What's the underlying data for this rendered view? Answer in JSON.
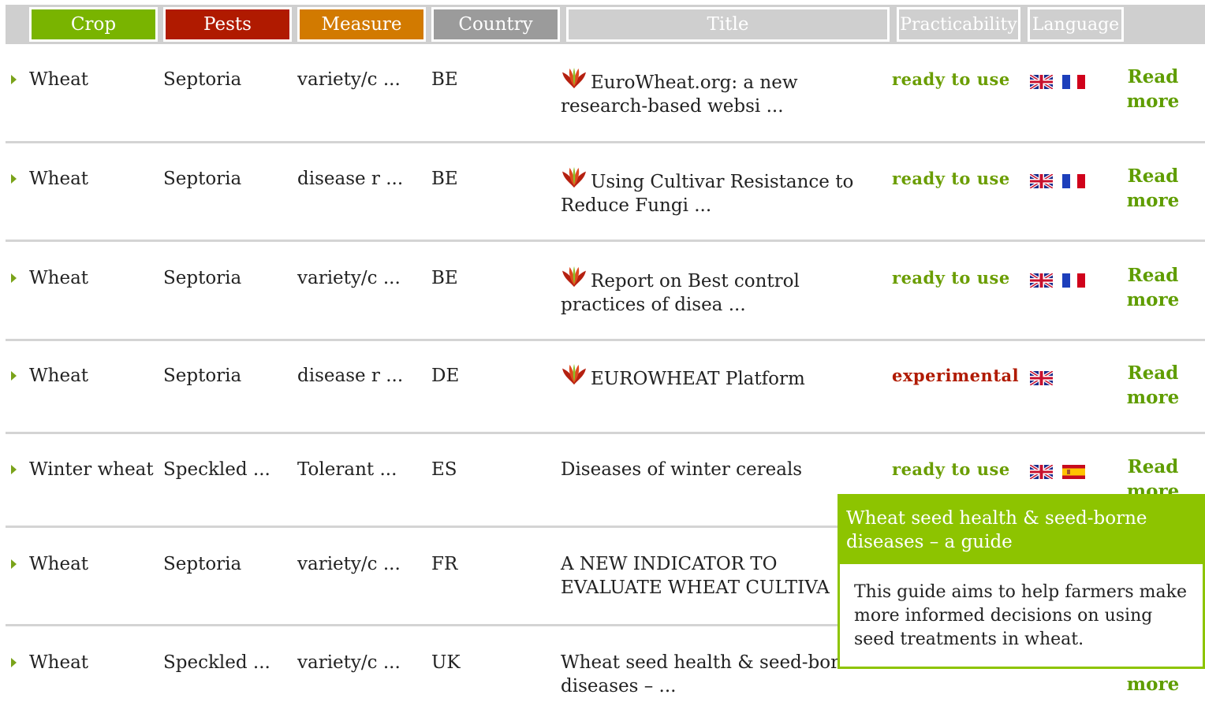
{
  "colors": {
    "crop_header": "#79b400",
    "pests_header": "#b01a00",
    "measure_header": "#d27a00",
    "country_header": "#9b9b9b",
    "plain_header": "#cfcfcf",
    "ready": "#6a9d00",
    "experimental": "#b01a00",
    "tooltip": "#8dc400"
  },
  "header": {
    "crop": "Crop",
    "pests": "Pests",
    "measure": "Measure",
    "country": "Country",
    "title": "Title",
    "practicability": "Practicability",
    "language": "Language"
  },
  "rows": [
    {
      "crop": "Wheat",
      "pest": "Septoria",
      "measure": "variety/c ...",
      "country": "BE",
      "title": "EuroWheat.org: a new research-based websi ...",
      "logo": "eurowheat-logo",
      "practicability": "ready to use",
      "prac_status": "ready",
      "flags": [
        "uk-flag",
        "france-flag"
      ],
      "read1": "Read",
      "read2": "more"
    },
    {
      "crop": "Wheat",
      "pest": "Septoria",
      "measure": "disease r ...",
      "country": "BE",
      "title": "Using Cultivar Resistance to Reduce Fungi ...",
      "logo": "eurowheat-logo",
      "practicability": "ready to use",
      "prac_status": "ready",
      "flags": [
        "uk-flag",
        "france-flag"
      ],
      "read1": "Read",
      "read2": "more"
    },
    {
      "crop": "Wheat",
      "pest": "Septoria",
      "measure": "variety/c ...",
      "country": "BE",
      "title": "Report on Best control practices of disea ...",
      "logo": "eurowheat-logo",
      "practicability": "ready to use",
      "prac_status": "ready",
      "flags": [
        "uk-flag",
        "france-flag"
      ],
      "read1": "Read",
      "read2": "more"
    },
    {
      "crop": "Wheat",
      "pest": "Septoria",
      "measure": "disease r ...",
      "country": "DE",
      "title": "EUROWHEAT Platform",
      "logo": "eurowheat-logo",
      "practicability": "experimental",
      "prac_status": "experimental",
      "flags": [
        "uk-flag"
      ],
      "read1": "Read",
      "read2": "more"
    },
    {
      "crop": "Winter wheat",
      "pest": "Speckled ...",
      "measure": "Tolerant ...",
      "country": "ES",
      "title": "Diseases of winter cereals",
      "logo": "",
      "practicability": "ready to use",
      "prac_status": "ready",
      "flags": [
        "uk-flag",
        "spain-flag"
      ],
      "read1": "Read",
      "read2": "more"
    },
    {
      "crop": "Wheat",
      "pest": "Septoria",
      "measure": "variety/c ...",
      "country": "FR",
      "title": "A NEW INDICATOR TO EVALUATE WHEAT CULTIVA",
      "logo": "",
      "practicability": "",
      "prac_status": "ready",
      "flags": [],
      "read1": "",
      "read2": ""
    },
    {
      "crop": "Wheat",
      "pest": "Speckled ...",
      "measure": "variety/c ...",
      "country": "UK",
      "title": "Wheat seed health & seed-borne diseases – ...",
      "logo": "",
      "practicability": "",
      "prac_status": "ready",
      "flags": [],
      "read1": "",
      "read2": "more"
    }
  ],
  "tooltip": {
    "title": "Wheat seed health & seed-borne diseases – a guide",
    "body": "This guide aims to help farmers make more informed decisions on using seed treatments in wheat."
  }
}
